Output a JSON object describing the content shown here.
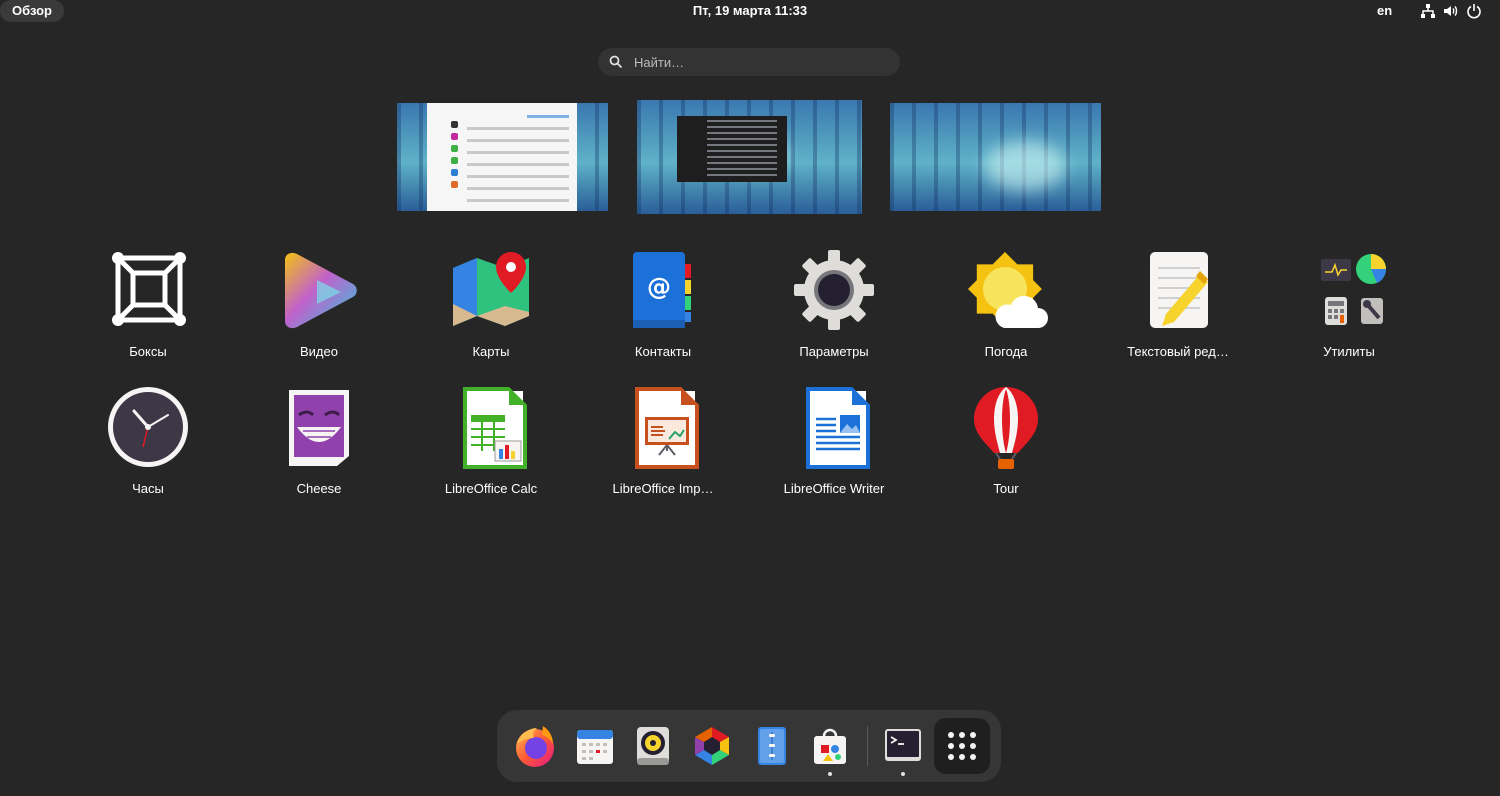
{
  "topbar": {
    "activities_label": "Обзор",
    "clock": "Пт, 19 марта  11:33",
    "language": "en"
  },
  "search": {
    "placeholder": "Найти…"
  },
  "apps": [
    {
      "label": "Боксы",
      "icon": "boxes-icon"
    },
    {
      "label": "Видео",
      "icon": "videos-icon"
    },
    {
      "label": "Карты",
      "icon": "maps-icon"
    },
    {
      "label": "Контакты",
      "icon": "contacts-icon"
    },
    {
      "label": "Параметры",
      "icon": "settings-icon"
    },
    {
      "label": "Погода",
      "icon": "weather-icon"
    },
    {
      "label": "Текстовый ред…",
      "icon": "text-editor-icon"
    },
    {
      "label": "Утилиты",
      "icon": "utilities-folder-icon"
    },
    {
      "label": "Часы",
      "icon": "clocks-icon"
    },
    {
      "label": "Cheese",
      "icon": "cheese-icon"
    },
    {
      "label": "LibreOffice Calc",
      "icon": "libreoffice-calc-icon"
    },
    {
      "label": "LibreOffice Imp…",
      "icon": "libreoffice-impress-icon"
    },
    {
      "label": "LibreOffice Writer",
      "icon": "libreoffice-writer-icon"
    },
    {
      "label": "Tour",
      "icon": "tour-icon"
    }
  ],
  "dash": [
    {
      "icon": "firefox-icon",
      "running": false
    },
    {
      "icon": "calendar-icon",
      "running": false
    },
    {
      "icon": "rhythmbox-icon",
      "running": false
    },
    {
      "icon": "photos-icon",
      "running": false
    },
    {
      "icon": "files-icon",
      "running": false
    },
    {
      "icon": "software-icon",
      "running": true
    },
    {
      "icon": "terminal-icon",
      "running": true
    },
    {
      "icon": "show-apps-icon",
      "running": false
    }
  ],
  "colors": {
    "background": "#262626",
    "dash": "#363636",
    "search": "#333333"
  }
}
